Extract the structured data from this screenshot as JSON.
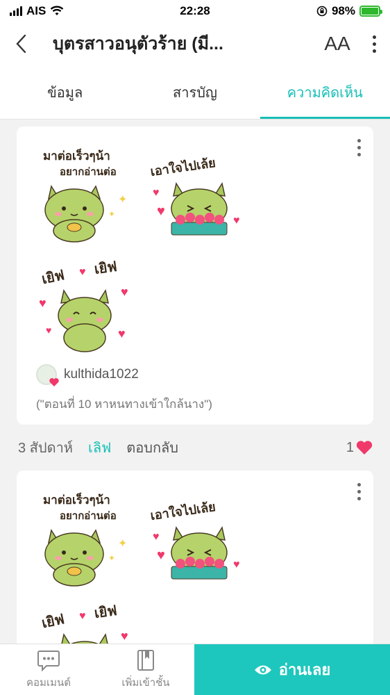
{
  "status_bar": {
    "carrier": "AIS",
    "time": "22:28",
    "battery": "98%",
    "battery_level": 0.98
  },
  "header": {
    "title": "บุตรสาวอนุตัวร้าย (มี...",
    "font_button": "AA"
  },
  "tabs": [
    {
      "label": "ข้อมูล",
      "active": false
    },
    {
      "label": "สารบัญ",
      "active": false
    },
    {
      "label": "ความคิดเห็น",
      "active": true
    }
  ],
  "comments": [
    {
      "stickers": [
        "มาต่อเร็วๆน้า อยากอ่านต่อ",
        "เอาใจไปเล้ย",
        "เยิฟ เยิฟ"
      ],
      "username": "kulthida1022",
      "chapter": "(\"ตอนที่ 10 หาหนทางเข้าใกล้นาง\")",
      "time": "3 สัปดาห์",
      "like_label": "เลิฟ",
      "reply_label": "ตอบกลับ",
      "like_count": "1"
    },
    {
      "stickers": [
        "มาต่อเร็วๆน้า อยากอ่านต่อ",
        "เอาใจไปเล้ย",
        "เยิฟ เยิฟ"
      ]
    }
  ],
  "bottom_bar": {
    "comment_label": "คอมเมนต์",
    "add_shelf_label": "เพิ่มเข้าชั้น",
    "read_label": "อ่านเลย"
  },
  "colors": {
    "accent": "#17bfb6",
    "read_button": "#1dc7bd",
    "heart": "#f0386b",
    "cat": "#b5d36a"
  }
}
